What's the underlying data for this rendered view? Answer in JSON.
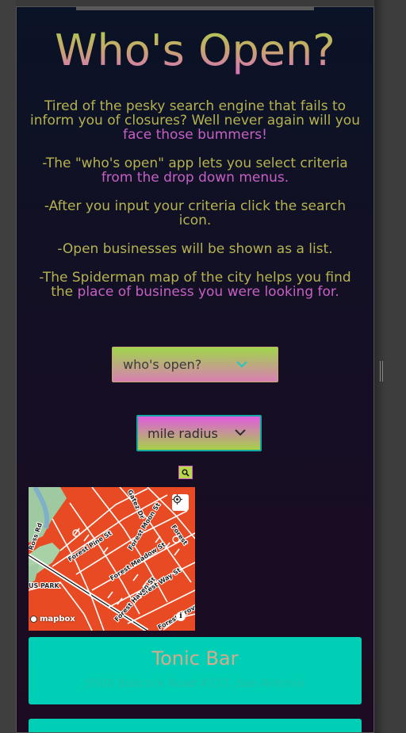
{
  "app": {
    "title": "Who's Open?",
    "intro": [
      {
        "c1": "Tired of the pesky search engine that fails to inform you of closures? Well never again will you",
        "c2": "face those bummers!"
      },
      {
        "c1": "-The \"who's open\" app lets you select criteria",
        "c2": "from the drop down menus."
      },
      {
        "c1": "-After you input your criteria click the search icon.",
        "c2": ""
      },
      {
        "c1": "-Open businesses will be shown as a list.",
        "c2": ""
      },
      {
        "c1": "-The Spiderman map of the city helps you find the",
        "c2": "place of business you were looking for."
      }
    ]
  },
  "filters": {
    "category": {
      "selected": "who's open?",
      "icon": "chevron-down-icon",
      "chevron_color": "#1fc9c0"
    },
    "radius": {
      "selected": "mile radius",
      "icon": "chevron-down-icon",
      "chevron_color": "#2d2d2d"
    }
  },
  "search": {
    "icon": "search-icon"
  },
  "map": {
    "labels": [
      "Forest Pine St",
      "Forest Meadow St",
      "Forest Moon St",
      "Forest Way St",
      "Forest Haven St",
      "Forest Grove",
      "Forest",
      "Gatez Dr",
      "Ross Rd",
      "US PARK"
    ],
    "attribution": "mapbox",
    "info": "i",
    "locate_icon": "crosshair-icon"
  },
  "results": [
    {
      "name": "Tonic Bar",
      "address": "5500 Babcock Road #117, San Antonio"
    },
    {
      "name": "",
      "address": ""
    }
  ],
  "colors": {
    "panel_top": "#0b1326",
    "panel_bottom": "#1c0b22",
    "title_green": "#a7d54a",
    "title_pink": "#d96ac8",
    "text_olive": "#b5b24f",
    "text_pink": "#c660c4",
    "card_teal": "#00cfb6",
    "map_red": "#e84b23"
  }
}
